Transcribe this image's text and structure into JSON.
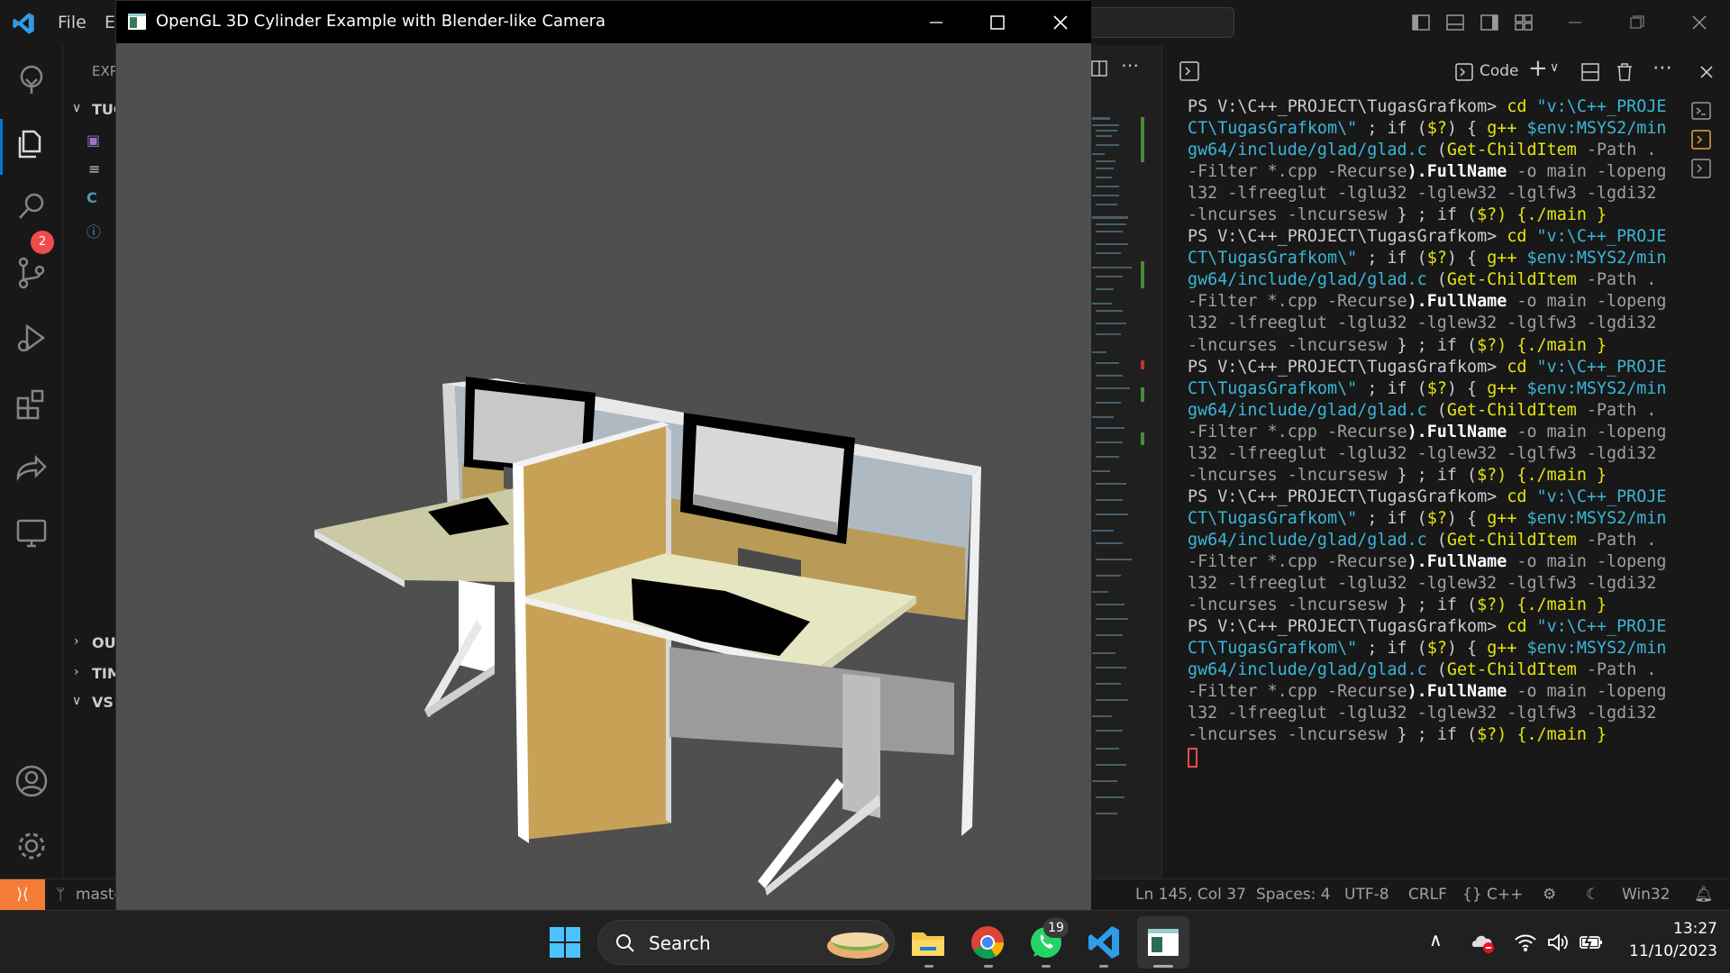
{
  "vscode": {
    "menu": {
      "file": "File",
      "edit": "E"
    },
    "sidebar": {
      "explorer_header": "EXP",
      "folder": "TUG",
      "sections": [
        "OU",
        "TIM",
        "VS"
      ]
    },
    "activity_badge_scm": "2",
    "terminal": {
      "profile_label": "Code",
      "prompt_path": "PS V:\\C++_PROJECT\\TugasGrafkom>",
      "command_parts": {
        "cd": "cd",
        "path_str": "\"v:\\C++_PROJECT\\TugasGrafkom\\\"",
        "sep1": "; if (",
        "status": "$?",
        "open_brace": ") { ",
        "gpp": "g++",
        "env": "$env:MSYS2/mingw64/include/glad/glad.c",
        "gci_open": " (",
        "gci": "Get-ChildItem",
        "gci_args": "-Path . -Filter *.cpp -Recurse",
        "fullname": ").FullName",
        "out_flag": "-o main",
        "libs": "-lopengl32 -lfreeglut -lglu32 -lglew32 -lglfw3 -lgdi32 -lncurses -lncursesw",
        "tail": " } ; if (",
        "run": ") {./main }"
      },
      "repeat_count": 5
    },
    "statusbar": {
      "branch": "maste",
      "position": "Ln 145, Col 37",
      "spaces": "Spaces: 4",
      "encoding": "UTF-8",
      "eol": "CRLF",
      "language": "{} C++",
      "platform": "Win32"
    }
  },
  "gl_window": {
    "title": "OpenGL 3D Cylinder Example with Blender-like Camera"
  },
  "taskbar": {
    "search_placeholder": "Search",
    "whatsapp_badge": "19",
    "time": "13:27",
    "date": "11/10/2023"
  }
}
